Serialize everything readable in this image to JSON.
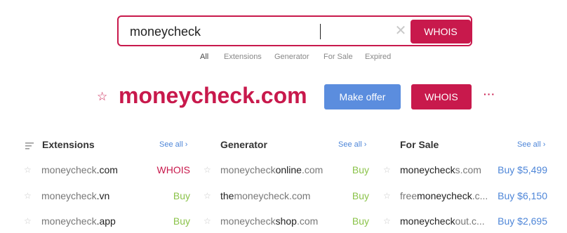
{
  "search": {
    "query": "moneycheck",
    "button_label": "WHOIS",
    "clear_glyph": "✕"
  },
  "filters": [
    "All",
    "Extensions",
    "Generator",
    "For Sale",
    "Expired"
  ],
  "hero": {
    "star_glyph": "☆",
    "domain": "moneycheck.com",
    "offer_label": "Make offer",
    "whois_label": "WHOIS",
    "more_glyph": "···"
  },
  "colors": {
    "brand": "#c8194c",
    "blue": "#5b8dde",
    "green": "#8bc34a",
    "link": "#4e86d8"
  },
  "columns": [
    {
      "title": "Extensions",
      "see_all": "See all ›",
      "icon": "list-filter-icon",
      "rows": [
        {
          "name": "moneycheck",
          "suffix": ".com",
          "action": "WHOIS",
          "kind": "whois"
        },
        {
          "name": "moneycheck",
          "suffix": ".vn",
          "action": "Buy",
          "kind": "buy"
        },
        {
          "name": "moneycheck",
          "suffix": ".app",
          "action": "Buy",
          "kind": "buy"
        }
      ]
    },
    {
      "title": "Generator",
      "see_all": "See all ›",
      "rows": [
        {
          "prefix": "moneycheck",
          "highlight": "online",
          "suffix": ".com",
          "action": "Buy",
          "kind": "buy"
        },
        {
          "prefix": "",
          "highlight": "the",
          "suffix": "moneycheck.com",
          "action": "Buy",
          "kind": "buy"
        },
        {
          "prefix": "moneycheck",
          "highlight": "shop",
          "suffix": ".com",
          "action": "Buy",
          "kind": "buy"
        }
      ]
    },
    {
      "title": "For Sale",
      "see_all": "See all ›",
      "rows": [
        {
          "prefix": "moneycheck",
          "highlight": "s",
          "suffix": ".com",
          "action": "Buy $5,499",
          "kind": "price"
        },
        {
          "prefix": "free",
          "highlight": "moneycheck",
          "suffix": ".c...",
          "action": "Buy $6,150",
          "kind": "price"
        },
        {
          "prefix": "moneycheck",
          "highlight": "out",
          "suffix": ".c...",
          "action": "Buy $2,695",
          "kind": "price"
        }
      ]
    }
  ]
}
